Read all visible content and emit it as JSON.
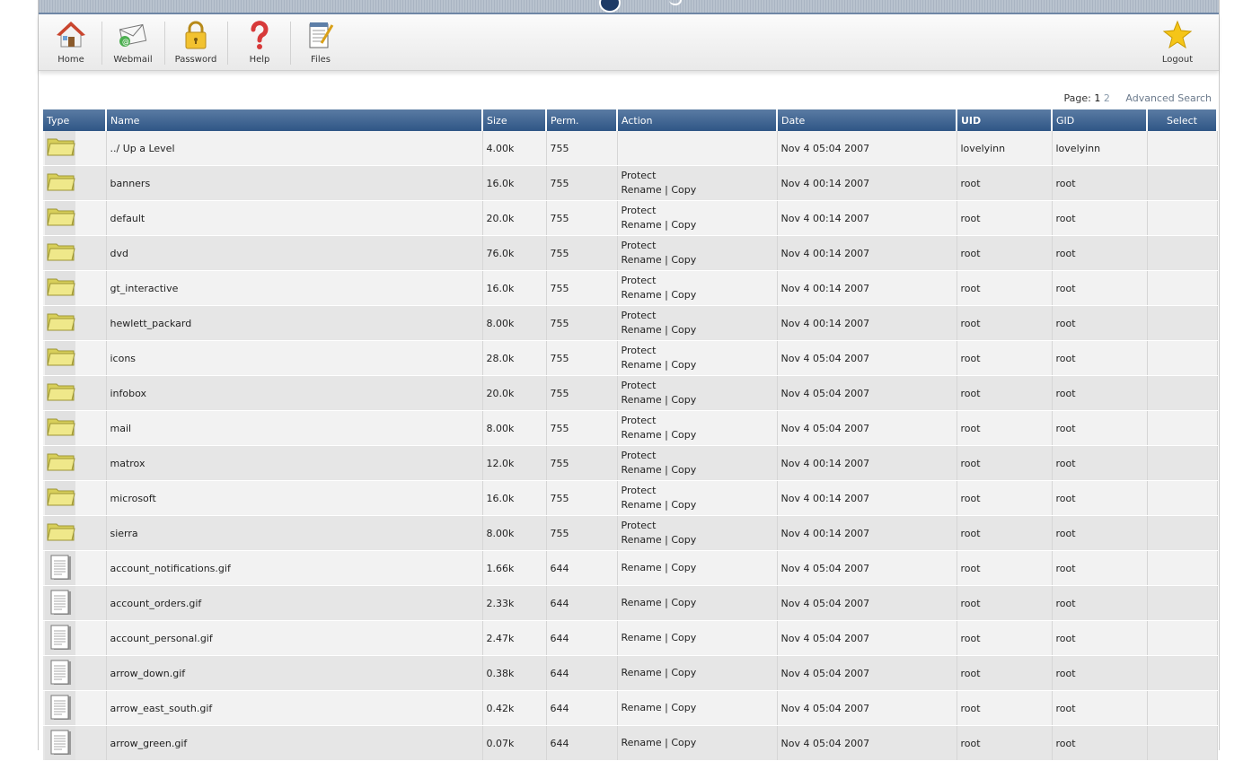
{
  "toolbar": {
    "items": [
      {
        "label": "Home",
        "icon": "home-icon"
      },
      {
        "label": "Webmail",
        "icon": "webmail-icon"
      },
      {
        "label": "Password",
        "icon": "padlock-icon"
      },
      {
        "label": "Help",
        "icon": "question-icon"
      },
      {
        "label": "Files",
        "icon": "files-icon"
      }
    ],
    "logout": {
      "label": "Logout",
      "icon": "star-icon"
    }
  },
  "pager": {
    "label": "Page:",
    "pages": [
      "1",
      "2"
    ],
    "current": "1",
    "advanced_search": "Advanced Search"
  },
  "table": {
    "headers": [
      "Type",
      "Name",
      "Size",
      "Perm.",
      "Action",
      "Date",
      "UID",
      "GID",
      "Select"
    ],
    "actions": {
      "protect": "Protect",
      "rename": "Rename",
      "sep": "|",
      "copy": "Copy"
    },
    "rows": [
      {
        "type": "folder",
        "name": "../ Up a Level",
        "size": "4.00k",
        "perm": "755",
        "protect": false,
        "actions": false,
        "date": "Nov 4 05:04 2007",
        "uid": "lovelyinn",
        "gid": "lovelyinn"
      },
      {
        "type": "folder",
        "name": "banners",
        "size": "16.0k",
        "perm": "755",
        "protect": true,
        "actions": true,
        "date": "Nov 4 00:14 2007",
        "uid": "root",
        "gid": "root"
      },
      {
        "type": "folder",
        "name": "default",
        "size": "20.0k",
        "perm": "755",
        "protect": true,
        "actions": true,
        "date": "Nov 4 00:14 2007",
        "uid": "root",
        "gid": "root"
      },
      {
        "type": "folder",
        "name": "dvd",
        "size": "76.0k",
        "perm": "755",
        "protect": true,
        "actions": true,
        "date": "Nov 4 00:14 2007",
        "uid": "root",
        "gid": "root"
      },
      {
        "type": "folder",
        "name": "gt_interactive",
        "size": "16.0k",
        "perm": "755",
        "protect": true,
        "actions": true,
        "date": "Nov 4 00:14 2007",
        "uid": "root",
        "gid": "root"
      },
      {
        "type": "folder",
        "name": "hewlett_packard",
        "size": "8.00k",
        "perm": "755",
        "protect": true,
        "actions": true,
        "date": "Nov 4 00:14 2007",
        "uid": "root",
        "gid": "root"
      },
      {
        "type": "folder",
        "name": "icons",
        "size": "28.0k",
        "perm": "755",
        "protect": true,
        "actions": true,
        "date": "Nov 4 05:04 2007",
        "uid": "root",
        "gid": "root"
      },
      {
        "type": "folder",
        "name": "infobox",
        "size": "20.0k",
        "perm": "755",
        "protect": true,
        "actions": true,
        "date": "Nov 4 05:04 2007",
        "uid": "root",
        "gid": "root"
      },
      {
        "type": "folder",
        "name": "mail",
        "size": "8.00k",
        "perm": "755",
        "protect": true,
        "actions": true,
        "date": "Nov 4 05:04 2007",
        "uid": "root",
        "gid": "root"
      },
      {
        "type": "folder",
        "name": "matrox",
        "size": "12.0k",
        "perm": "755",
        "protect": true,
        "actions": true,
        "date": "Nov 4 00:14 2007",
        "uid": "root",
        "gid": "root"
      },
      {
        "type": "folder",
        "name": "microsoft",
        "size": "16.0k",
        "perm": "755",
        "protect": true,
        "actions": true,
        "date": "Nov 4 00:14 2007",
        "uid": "root",
        "gid": "root"
      },
      {
        "type": "folder",
        "name": "sierra",
        "size": "8.00k",
        "perm": "755",
        "protect": true,
        "actions": true,
        "date": "Nov 4 00:14 2007",
        "uid": "root",
        "gid": "root"
      },
      {
        "type": "file",
        "name": "account_notifications.gif",
        "size": "1.66k",
        "perm": "644",
        "protect": false,
        "actions": true,
        "date": "Nov 4 05:04 2007",
        "uid": "root",
        "gid": "root"
      },
      {
        "type": "file",
        "name": "account_orders.gif",
        "size": "2.33k",
        "perm": "644",
        "protect": false,
        "actions": true,
        "date": "Nov 4 05:04 2007",
        "uid": "root",
        "gid": "root"
      },
      {
        "type": "file",
        "name": "account_personal.gif",
        "size": "2.47k",
        "perm": "644",
        "protect": false,
        "actions": true,
        "date": "Nov 4 05:04 2007",
        "uid": "root",
        "gid": "root"
      },
      {
        "type": "file",
        "name": "arrow_down.gif",
        "size": "0.38k",
        "perm": "644",
        "protect": false,
        "actions": true,
        "date": "Nov 4 05:04 2007",
        "uid": "root",
        "gid": "root"
      },
      {
        "type": "file",
        "name": "arrow_east_south.gif",
        "size": "0.42k",
        "perm": "644",
        "protect": false,
        "actions": true,
        "date": "Nov 4 05:04 2007",
        "uid": "root",
        "gid": "root"
      },
      {
        "type": "file",
        "name": "arrow_green.gif",
        "size": "0.07k",
        "perm": "644",
        "protect": false,
        "actions": true,
        "date": "Nov 4 05:04 2007",
        "uid": "root",
        "gid": "root"
      }
    ]
  },
  "colors": {
    "header_top": "#5a7ba3",
    "header_bottom": "#2f5686",
    "folder_fill": "#e9e27a",
    "row_light": "#f2f2f2",
    "row_dark": "#e6e6e6"
  }
}
